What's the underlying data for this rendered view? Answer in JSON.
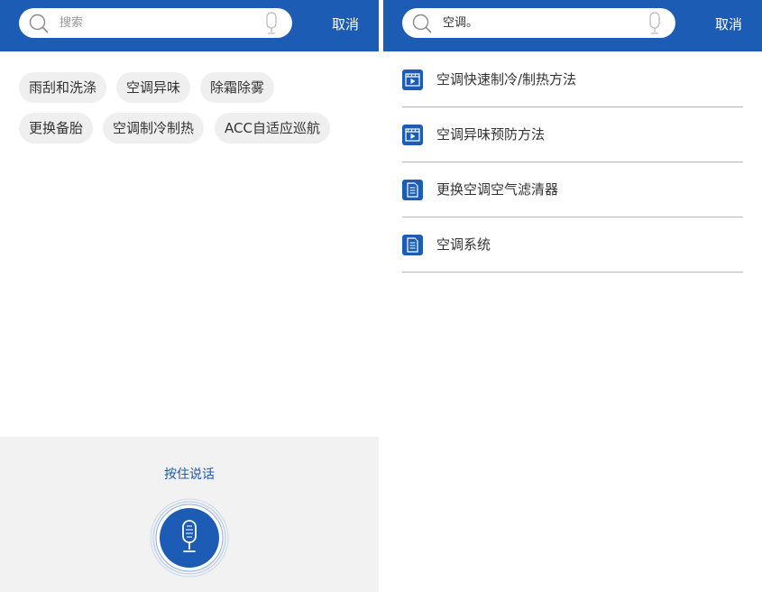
{
  "left_screen": {
    "search": {
      "placeholder": "搜索",
      "cancel_label": "取消"
    },
    "suggestion_tags": [
      {
        "label": "雨刮和洗涤"
      },
      {
        "label": "空调异味"
      },
      {
        "label": "除霜除雾"
      },
      {
        "label": "更换备胎"
      },
      {
        "label": "空调制冷制热"
      },
      {
        "label": "ACC自适应巡航"
      }
    ],
    "voice": {
      "label": "按住说话",
      "mic_icon": "microphone-icon"
    }
  },
  "right_screen": {
    "search": {
      "value": "空调。",
      "cancel_label": "取消"
    },
    "results": [
      {
        "label": "空调快速制冷/制热方法",
        "icon": "video-icon"
      },
      {
        "label": "空调异味预防方法",
        "icon": "video-icon"
      },
      {
        "label": "更换空调空气滤清器",
        "icon": "document-icon"
      },
      {
        "label": "空调系统",
        "icon": "document-icon"
      }
    ]
  },
  "colors": {
    "brand_blue": "#1c5cb4",
    "tag_background": "#efefef",
    "voice_panel_background": "#f2f2f2",
    "separator": "#b5b5b5"
  }
}
